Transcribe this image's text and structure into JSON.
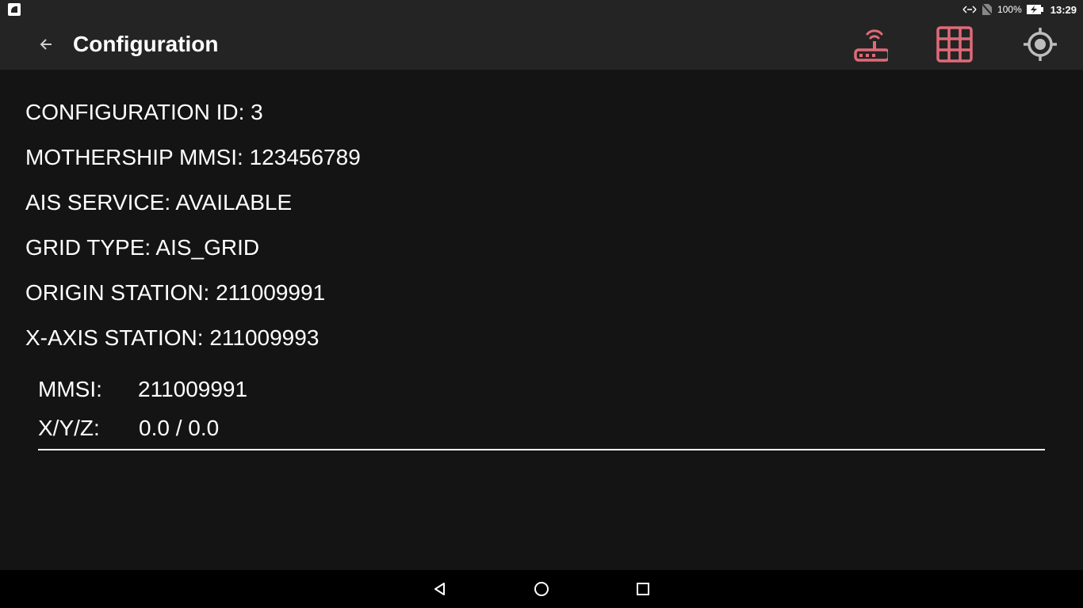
{
  "status_bar": {
    "battery": "100%",
    "time": "13:29",
    "icons": [
      "notification-icon",
      "data-transfer-icon",
      "no-sim-icon",
      "battery-charging-icon"
    ]
  },
  "app_bar": {
    "title": "Configuration",
    "back_icon": "arrow-back-icon",
    "actions": [
      "router-icon",
      "grid-icon",
      "gps-fixed-icon"
    ],
    "accent_color": "#e06a78"
  },
  "config": {
    "configuration_id": "CONFIGURATION ID: 3",
    "mothership_mmsi": "MOTHERSHIP MMSI: 123456789",
    "ais_service": "AIS SERVICE: AVAILABLE",
    "grid_type": "GRID TYPE: AIS_GRID",
    "origin_station": "ORIGIN STATION: 211009991",
    "x_axis_station": "X-AXIS STATION: 211009993"
  },
  "station": {
    "mmsi_label": "MMSI:",
    "mmsi_value": "211009991",
    "xyz_label": "X/Y/Z:",
    "xyz_value": "0.0 / 0.0"
  },
  "nav_bar": {
    "icons": [
      "nav-back-icon",
      "nav-home-icon",
      "nav-recents-icon"
    ]
  }
}
